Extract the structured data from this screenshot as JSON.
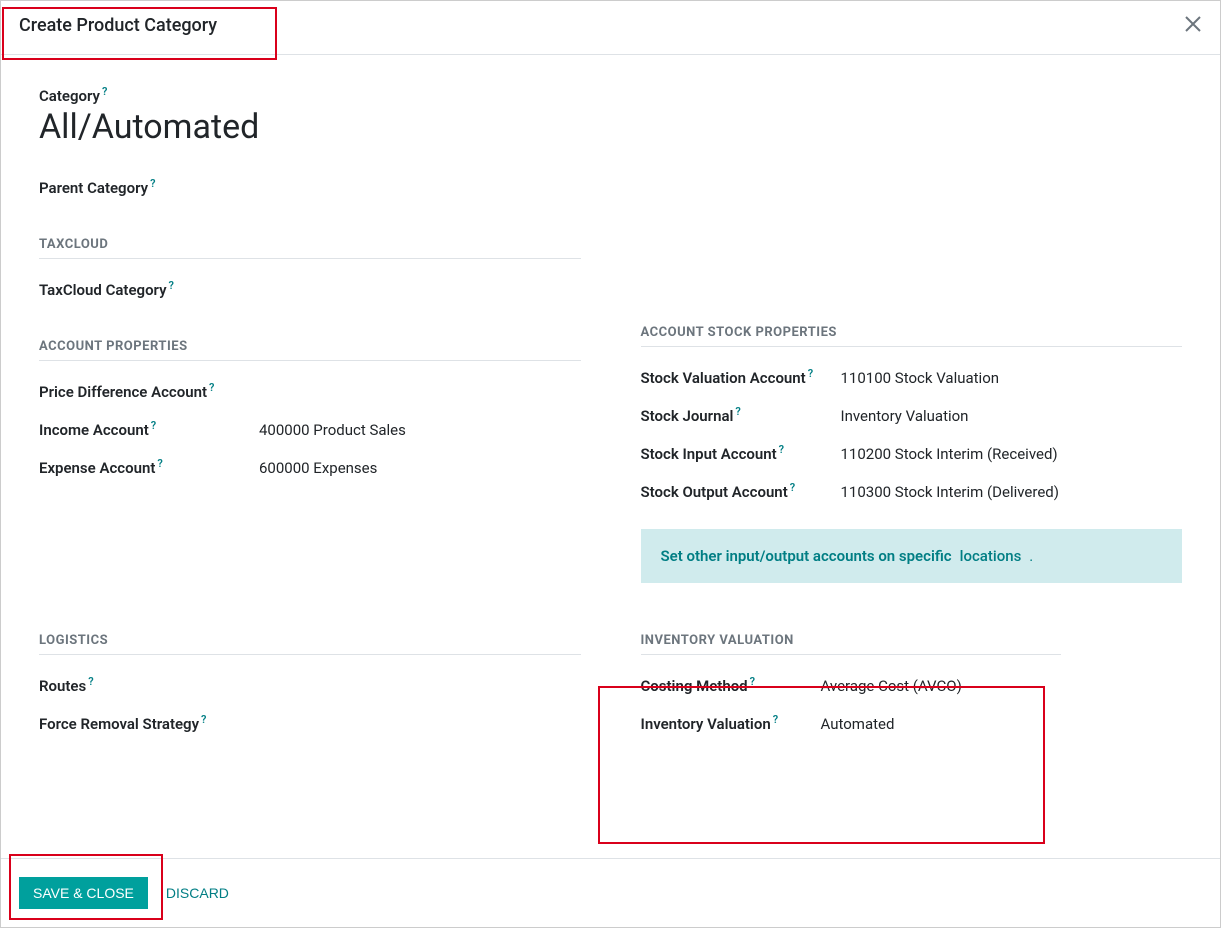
{
  "header": {
    "title": "Create Product Category"
  },
  "category": {
    "label": "Category",
    "name": "All/Automated"
  },
  "parent": {
    "label": "Parent Category"
  },
  "sections": {
    "taxcloud": {
      "title": "TAXCLOUD",
      "taxcloud_category_label": "TaxCloud Category"
    },
    "account_props": {
      "title": "ACCOUNT PROPERTIES",
      "price_diff_label": "Price Difference Account",
      "income_label": "Income Account",
      "income_value": "400000 Product Sales",
      "expense_label": "Expense Account",
      "expense_value": "600000 Expenses"
    },
    "account_stock": {
      "title": "ACCOUNT STOCK PROPERTIES",
      "stock_valuation_label": "Stock Valuation Account",
      "stock_valuation_value": "110100 Stock Valuation",
      "stock_journal_label": "Stock Journal",
      "stock_journal_value": "Inventory Valuation",
      "stock_input_label": "Stock Input Account",
      "stock_input_value": "110200 Stock Interim (Received)",
      "stock_output_label": "Stock Output Account",
      "stock_output_value": "110300 Stock Interim (Delivered)"
    },
    "info": {
      "text": "Set other input/output accounts on specific",
      "link": "locations",
      "dot": "."
    },
    "logistics": {
      "title": "LOGISTICS",
      "routes_label": "Routes",
      "force_removal_label": "Force Removal Strategy"
    },
    "inventory_valuation": {
      "title": "INVENTORY VALUATION",
      "costing_method_label": "Costing Method",
      "costing_method_value": "Average Cost (AVCO)",
      "inventory_valuation_label": "Inventory Valuation",
      "inventory_valuation_value": "Automated"
    }
  },
  "footer": {
    "save_label": "SAVE & CLOSE",
    "discard_label": "DISCARD"
  },
  "help": "?"
}
